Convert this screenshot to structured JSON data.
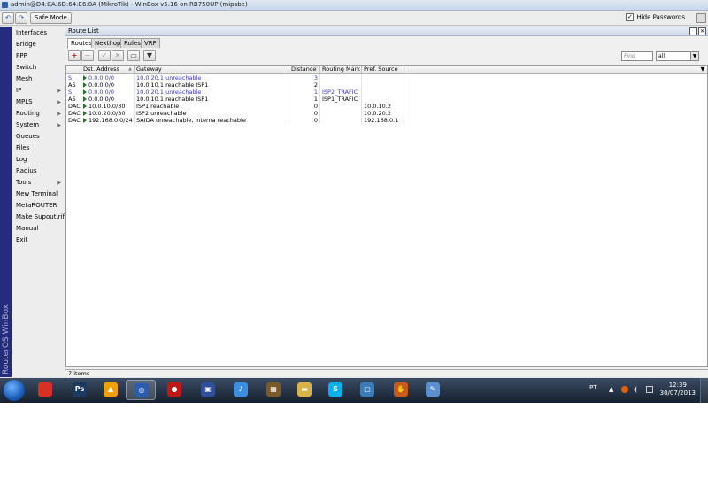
{
  "window": {
    "title": "admin@D4:CA:6D:64:E6:8A (MikroTik) - WinBox v5.16 on RB750UP (mipsbe)"
  },
  "toolbar": {
    "safe_mode_label": "Safe Mode",
    "hide_passwords_label": "Hide Passwords",
    "hide_passwords_checked": "✓"
  },
  "sidebar": {
    "brand_text": "RouterOS WinBox",
    "items": [
      {
        "label": "Interfaces"
      },
      {
        "label": "Bridge"
      },
      {
        "label": "PPP"
      },
      {
        "label": "Switch"
      },
      {
        "label": "Mesh"
      },
      {
        "label": "IP",
        "submenu": true
      },
      {
        "label": "MPLS",
        "submenu": true
      },
      {
        "label": "Routing",
        "submenu": true
      },
      {
        "label": "System",
        "submenu": true
      },
      {
        "label": "Queues"
      },
      {
        "label": "Files"
      },
      {
        "label": "Log"
      },
      {
        "label": "Radius"
      },
      {
        "label": "Tools",
        "submenu": true
      },
      {
        "label": "New Terminal"
      },
      {
        "label": "MetaROUTER"
      },
      {
        "label": "Make Supout.rif"
      },
      {
        "label": "Manual"
      },
      {
        "label": "Exit"
      }
    ]
  },
  "route_list": {
    "title": "Route List",
    "tabs": [
      "Routes",
      "Nexthops",
      "Rules",
      "VRF"
    ],
    "find_placeholder": "Find",
    "filter_value": "all",
    "columns": [
      "",
      "Dst. Address",
      "Gateway",
      "Distance",
      "Routing Mark",
      "Pref. Source"
    ],
    "rows": [
      {
        "flags": "S",
        "dst": "0.0.0.0/0",
        "gateway": "10.0.20.1 unreachable",
        "distance": "3",
        "mark": "",
        "pref_src": "",
        "highlight": true
      },
      {
        "flags": "AS",
        "dst": "0.0.0.0/0",
        "gateway": "10.0.10.1 reachable ISP1",
        "distance": "2",
        "mark": "",
        "pref_src": "",
        "highlight": false
      },
      {
        "flags": "S",
        "dst": "0.0.0.0/0",
        "gateway": "10.0.20.1 unreachable",
        "distance": "1",
        "mark": "ISP2_TRAFIC",
        "pref_src": "",
        "highlight": true
      },
      {
        "flags": "AS",
        "dst": "0.0.0.0/0",
        "gateway": "10.0.10.1 reachable ISP1",
        "distance": "1",
        "mark": "ISP1_TRAFIC",
        "pref_src": "",
        "highlight": false
      },
      {
        "flags": "DAC",
        "dst": "10.0.10.0/30",
        "gateway": "ISP1 reachable",
        "distance": "0",
        "mark": "",
        "pref_src": "10.0.10.2",
        "highlight": false
      },
      {
        "flags": "DAC",
        "dst": "10.0.20.0/30",
        "gateway": "ISP2 unreachable",
        "distance": "0",
        "mark": "",
        "pref_src": "10.0.20.2",
        "highlight": false
      },
      {
        "flags": "DAC",
        "dst": "192.168.0.0/24",
        "gateway": "SAIDA unreachable, interna reachable",
        "distance": "0",
        "mark": "",
        "pref_src": "192.168.0.1",
        "highlight": false
      }
    ],
    "status": "7 items"
  },
  "taskbar": {
    "apps": [
      {
        "name": "chrome-icon",
        "glyph": "",
        "color": "#d93025"
      },
      {
        "name": "photoshop-icon",
        "glyph": "Ps",
        "color": "#1b3a63"
      },
      {
        "name": "aimp-icon",
        "glyph": "▲",
        "color": "#f0a000"
      },
      {
        "name": "winbox-icon",
        "glyph": "◎",
        "color": "#2a5db0"
      },
      {
        "name": "record-icon",
        "glyph": "●",
        "color": "#c01818"
      },
      {
        "name": "monitor-icon",
        "glyph": "▣",
        "color": "#2e4f9c"
      },
      {
        "name": "itunes-icon",
        "glyph": "♪",
        "color": "#3b8ee0"
      },
      {
        "name": "film-icon",
        "glyph": "▦",
        "color": "#7a5a2a"
      },
      {
        "name": "folder-icon",
        "glyph": "▬",
        "color": "#d9b34a"
      },
      {
        "name": "skype-icon",
        "glyph": "S",
        "color": "#00aff0"
      },
      {
        "name": "remote-icon",
        "glyph": "▢",
        "color": "#3b7bb8"
      },
      {
        "name": "hand-icon",
        "glyph": "✋",
        "color": "#c85a1a"
      },
      {
        "name": "paint-icon",
        "glyph": "✎",
        "color": "#5a8fd0"
      }
    ],
    "language": "PT",
    "time": "12:39",
    "date": "30/07/2013"
  }
}
